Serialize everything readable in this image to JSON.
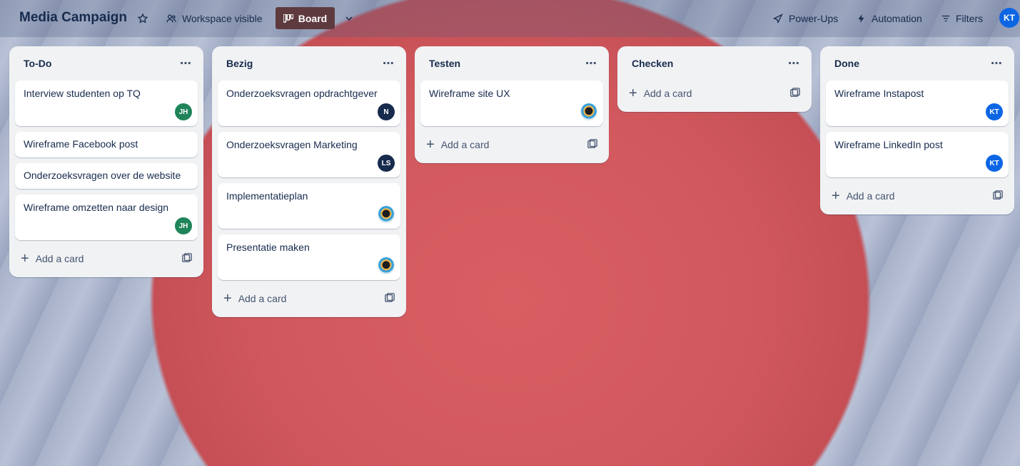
{
  "header": {
    "title": "Media Campaign",
    "star_icon": "star-icon",
    "visibility_label": "Workspace visible",
    "view_label": "Board",
    "power_ups_label": "Power-Ups",
    "automation_label": "Automation",
    "filters_label": "Filters",
    "user_initials": "KT"
  },
  "colors": {
    "accent_board_btn": "#5e3a3f",
    "avatar_green": "#1f845a",
    "avatar_navy": "#172b4d",
    "avatar_blue": "#0c66e4"
  },
  "lists": [
    {
      "title": "To-Do",
      "cards": [
        {
          "title": "Interview studenten op TQ",
          "avatar": "JH"
        },
        {
          "title": "Wireframe Facebook post",
          "avatar": ""
        },
        {
          "title": "Onderzoeksvragen over de website",
          "avatar": ""
        },
        {
          "title": "Wireframe omzetten naar design",
          "avatar": "JH"
        }
      ],
      "add_label": "Add a card"
    },
    {
      "title": "Bezig",
      "cards": [
        {
          "title": "Onderzoeksvragen opdrachtgever",
          "avatar": "N"
        },
        {
          "title": "Onderzoeksvragen Marketing",
          "avatar": "LS"
        },
        {
          "title": "Implementatieplan",
          "avatar": "photo"
        },
        {
          "title": "Presentatie maken",
          "avatar": "photo"
        }
      ],
      "add_label": "Add a card"
    },
    {
      "title": "Testen",
      "cards": [
        {
          "title": "Wireframe site UX",
          "avatar": "photo"
        }
      ],
      "add_label": "Add a card"
    },
    {
      "title": "Checken",
      "cards": [],
      "add_label": "Add a card"
    },
    {
      "title": "Done",
      "cards": [
        {
          "title": "Wireframe Instapost",
          "avatar": "KT"
        },
        {
          "title": "Wireframe LinkedIn post",
          "avatar": "KT"
        }
      ],
      "add_label": "Add a card"
    }
  ]
}
